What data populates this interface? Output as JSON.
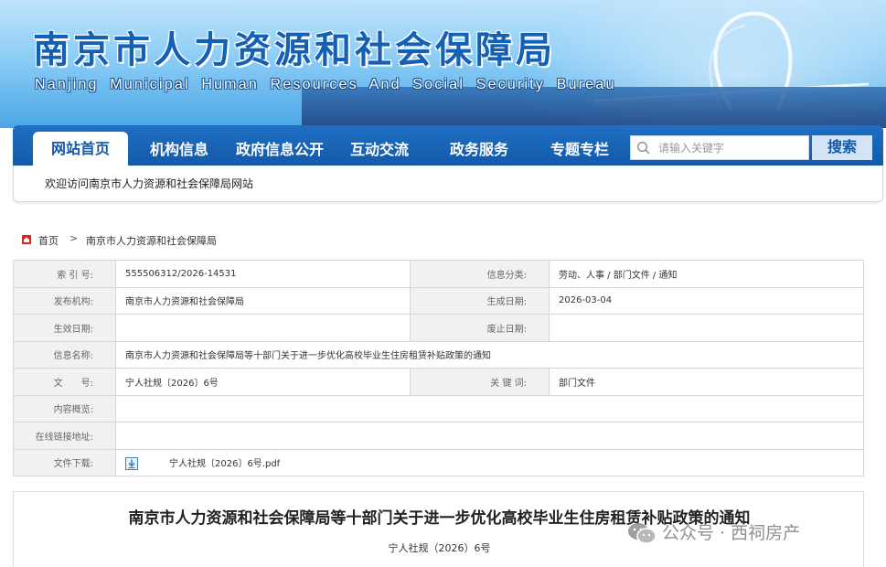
{
  "header": {
    "title_cn": "南京市人力资源和社会保障局",
    "title_en": "Nanjing Municipal Human Resources And Social Security Bureau"
  },
  "nav": {
    "items": [
      "网站首页",
      "机构信息",
      "政府信息公开",
      "互动交流",
      "政务服务",
      "专题专栏"
    ],
    "active": "网站首页",
    "search_placeholder": "请输入关键字",
    "search_button": "搜索"
  },
  "welcome": "欢迎访问南京市人力资源和社会保障局网站",
  "breadcrumb": {
    "home": "首页",
    "separator": ">",
    "current": "南京市人力资源和社会保障局"
  },
  "info": {
    "index_label": "索 引 号:",
    "index_value": "555506312/2026-14531",
    "category_label": "信息分类:",
    "category_value": "劳动、人事 / 部门文件 / 通知",
    "issuer_label": "发布机构:",
    "issuer_value": "南京市人力资源和社会保障局",
    "generated_label": "生成日期:",
    "generated_value": "2026-03-04",
    "effective_label": "生效日期:",
    "effective_value": "",
    "expiry_label": "废止日期:",
    "expiry_value": "",
    "name_label": "信息名称:",
    "name_value": "南京市人力资源和社会保障局等十部门关于进一步优化高校毕业生住房租赁补贴政策的通知",
    "docno_label": "文　　号:",
    "docno_value": "宁人社规〔2026〕6号",
    "keyword_label": "关 键 词:",
    "keyword_value": "部门文件",
    "summary_label": "内容概览:",
    "summary_value": "",
    "link_label": "在线链接地址:",
    "link_value": "",
    "download_label": "文件下载:",
    "download_value": "宁人社规〔2026〕6号.pdf"
  },
  "article": {
    "title": "南京市人力资源和社会保障局等十部门关于进一步优化高校毕业生住房租赁补贴政策的通知",
    "doc_number": "宁人社规（2026）6号"
  },
  "watermark": "公众号 · 西祠房产",
  "colors": {
    "nav_blue": "#1459a8",
    "title_blue": "#1360b5",
    "label_bg": "#f1f1f1"
  }
}
